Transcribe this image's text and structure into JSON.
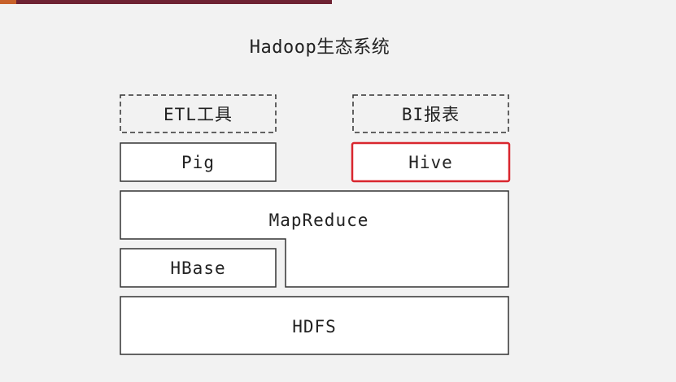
{
  "slide": {
    "title": "Hadoop生态系统",
    "accent_color": "#6e2233",
    "highlight_color": "#d9262e"
  },
  "diagram": {
    "boxes": {
      "etl": "ETL工具",
      "bi": "BI报表",
      "pig": "Pig",
      "hive": "Hive",
      "mapreduce": "MapReduce",
      "hbase": "HBase",
      "hdfs": "HDFS"
    },
    "highlighted": "Hive"
  }
}
